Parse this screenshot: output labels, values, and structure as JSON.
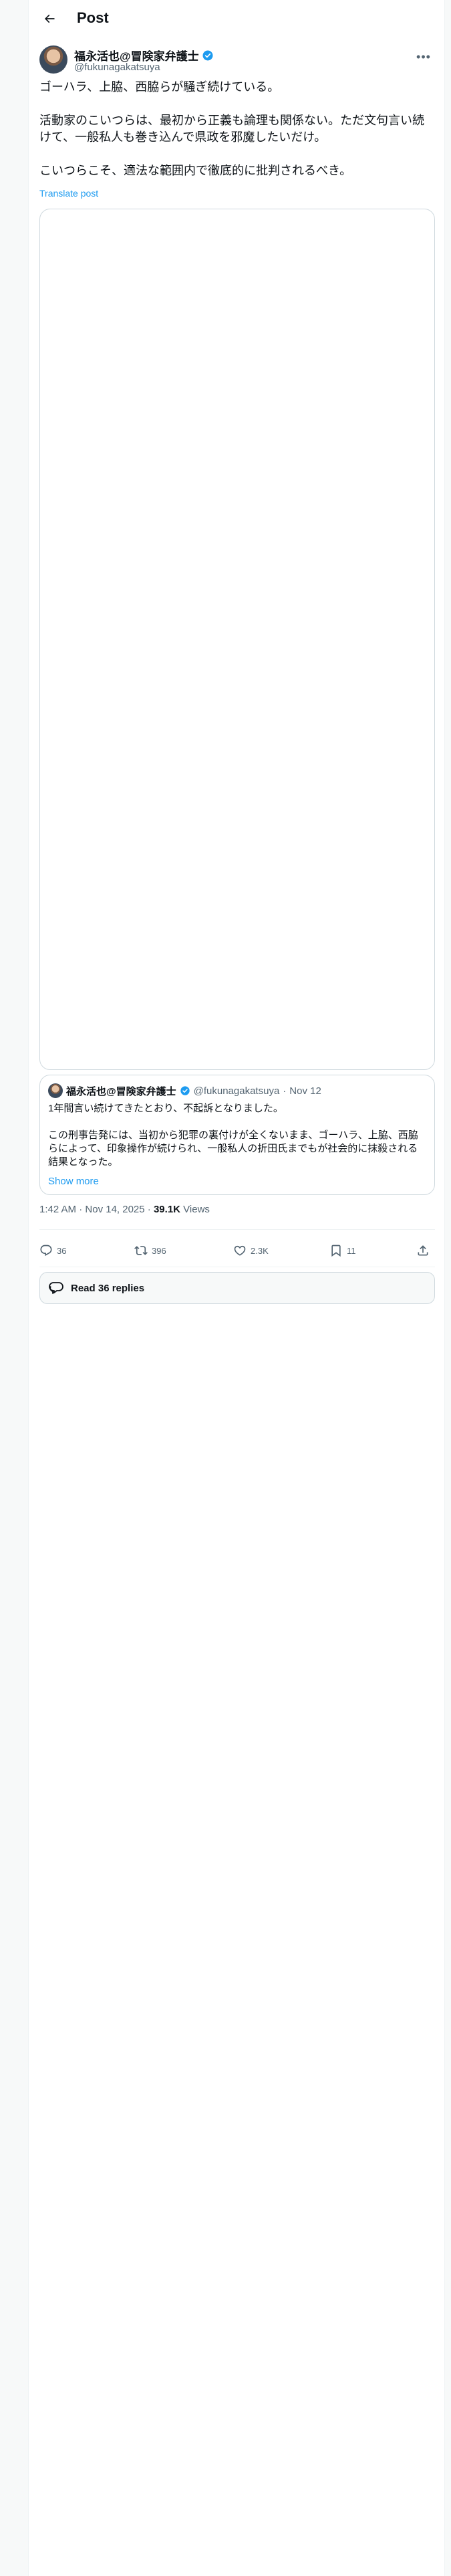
{
  "header": {
    "title": "Post",
    "back_icon": "arrow-left-icon"
  },
  "author": {
    "name": "福永活也@冒険家弁護士",
    "handle": "@fukunagakatsuya",
    "verified": true,
    "more_icon": "more-dots-icon"
  },
  "tweet": {
    "paragraphs": [
      "ゴーハラ、上脇、西脇らが騒ぎ続けている。",
      "",
      "活動家のこいつらは、最初から正義も論理も関係ない。ただ文句言い続けて、一般私人も巻き込んで県政を邪魔したいだけ。",
      "",
      "こいつらこそ、適法な範囲内で徹底的に批判されるべき。"
    ],
    "translate_label": "Translate post"
  },
  "quote": {
    "name": "福永活也@冒険家弁護士",
    "handle": "@fukunagakatsuya",
    "separator": "·",
    "date": "Nov 12",
    "paragraphs": [
      "1年間言い続けてきたとおり、不起訴となりました。",
      "",
      "この刑事告発には、当初から犯罪の裏付けが全くないまま、ゴーハラ、上脇、西脇らによって、印象操作が続けられ、一般私人の折田氏までもが社会的に抹殺される結果となった。"
    ],
    "show_more_label": "Show more"
  },
  "meta": {
    "time": "1:42 AM",
    "separator": "·",
    "date": "Nov 14, 2025",
    "views_count": "39.1K",
    "views_label": "Views"
  },
  "actions": {
    "replies": "36",
    "reposts": "396",
    "likes": "2.3K",
    "bookmarks": "11"
  },
  "read_replies_label": "Read 36 replies",
  "colors": {
    "accent": "#1d9bf0",
    "text": "#0f1419",
    "secondary": "#536471",
    "border": "#cfd9de"
  }
}
